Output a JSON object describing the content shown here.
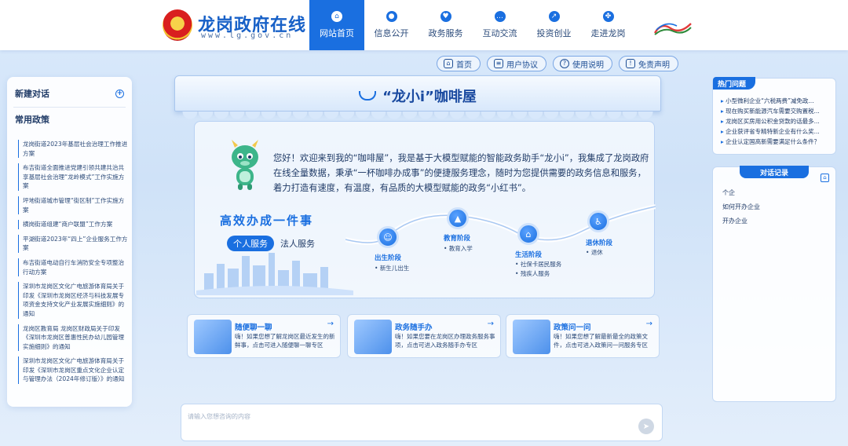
{
  "header": {
    "site_title": "龙岗政府在线",
    "site_url": "www.lg.gov.cn",
    "nav": [
      {
        "label": "网站首页",
        "icon": "home-icon",
        "active": true
      },
      {
        "label": "信息公开",
        "icon": "info-icon"
      },
      {
        "label": "政务服务",
        "icon": "heart-icon"
      },
      {
        "label": "互动交流",
        "icon": "chat-icon"
      },
      {
        "label": "投资创业",
        "icon": "invest-icon"
      },
      {
        "label": "走进龙岗",
        "icon": "grid-icon"
      }
    ]
  },
  "toplinks": [
    {
      "label": "首页",
      "icon": "home-icon"
    },
    {
      "label": "用户协议",
      "icon": "document-icon"
    },
    {
      "label": "使用说明",
      "icon": "help-icon"
    },
    {
      "label": "免责声明",
      "icon": "shield-icon"
    }
  ],
  "left": {
    "new_chat": "新建对话",
    "policy_title": "常用政策",
    "policies": [
      "龙岗街道2023年基层社会治理工作推进方案",
      "布吉街道全面推进党建引领共建共治共享基层社会治理“龙岭模式”工作实施方案",
      "坪地街道城市管理“街区制”工作实施方案",
      "横岗街道组建“商户联盟”工作方案",
      "平湖街道2023年“四上”企业服务工作方案",
      "布吉街道电动自行车消防安全专项整治行动方案",
      "深圳市龙岗区文化广电旅游体育局关于印发《深圳市龙岗区经济与科技发展专项资金支持文化产业发展实施细则》的通知",
      "龙岗区教育局 龙岗区财政局关于印发《深圳市龙岗区普惠性民办幼儿园管理实施细则》的通知",
      "深圳市龙岗区文化广电旅游体育局关于印发《深圳市龙岗区重点文化企业认定与管理办法（2024年修订版）》的通知"
    ]
  },
  "center": {
    "cafe_title": "“龙小i”咖啡屋",
    "welcome": "您好！欢迎来到我的“咖啡屋”，我是基于大模型赋能的智能政务助手“龙小i”，我集成了龙岗政府在线全量数据，秉承“一杯咖啡办成事”的便捷服务理念，随时为您提供需要的政务信息和服务，着力打造有速度，有温度，有品质的大模型赋能的政务“小红书”。",
    "slogan": "高效办成一件事",
    "tabs": [
      {
        "label": "个人服务",
        "active": true
      },
      {
        "label": "法人服务",
        "active": false
      }
    ],
    "stages": [
      {
        "label": "出生阶段",
        "items": [
          "新生儿出生"
        ],
        "icon": "baby-icon"
      },
      {
        "label": "教育阶段",
        "items": [
          "教育入学"
        ],
        "icon": "graduation-cap-icon"
      },
      {
        "label": "生活阶段",
        "items": [
          "社保卡居民服务",
          "残疾人服务"
        ],
        "icon": "house-icon"
      },
      {
        "label": "退休阶段",
        "items": [
          "退休"
        ],
        "icon": "walking-icon"
      }
    ],
    "services": [
      {
        "title": "随便聊一聊",
        "desc": "嗨！如果您想了解龙岗区最近发生的新鲜事，点击可进入随便聊一聊专区"
      },
      {
        "title": "政务随手办",
        "desc": "嗨！如果您要在龙岗区办理政务服务事项，点击可进入政务随手办专区"
      },
      {
        "title": "政策问一问",
        "desc": "嗨！如果您想了解最新最全的政策文件，点击可进入政策问一问服务专区"
      }
    ],
    "input_placeholder": "请输入您想咨询的内容"
  },
  "right": {
    "hot_title": "热门问题",
    "hot_questions": [
      "小型微利企业“六税两费”减免政...",
      "现在购买新能源汽车需要交购置税...",
      "龙岗区买房用公积金贷款的话最多...",
      "企业获评省专精特新企业有什么奖...",
      "企业认定国高新需要满足什么条件？"
    ],
    "history_title": "对话记录",
    "history": [
      "个企",
      "如何开办企业",
      "开办企业"
    ]
  },
  "colors": {
    "accent": "#1a6fe0",
    "nav_active_bg": "#1a6fe0",
    "background": "#d6e7fa"
  }
}
